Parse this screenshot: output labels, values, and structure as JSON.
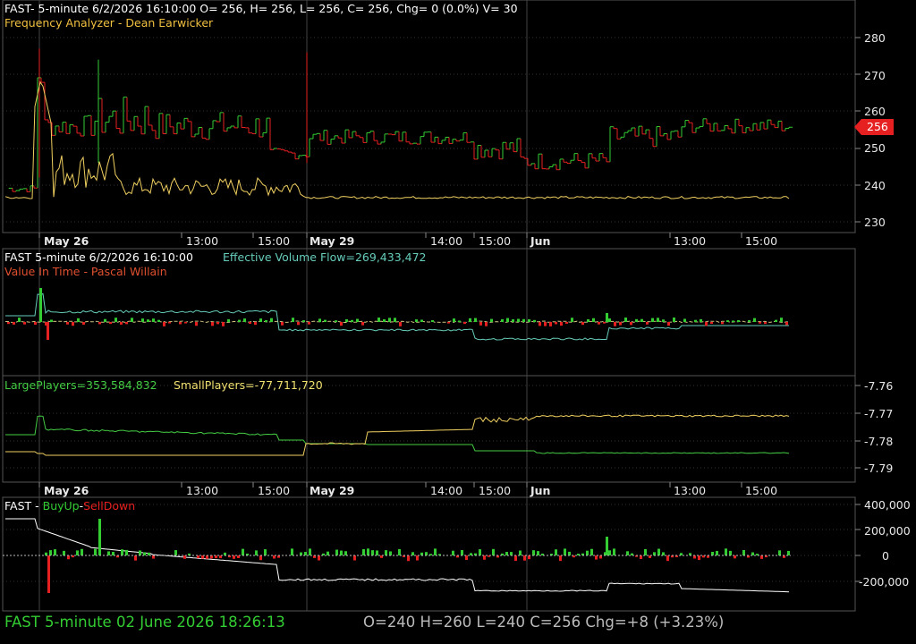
{
  "pane1": {
    "header": "FAST- 5-minute 6/2/2026 16:10:00 O= 256, H= 256, L= 256, C= 256, Chg= 0 (0.0%) V= 30",
    "study": "Frequency Analyzer - Dean Earwicker",
    "price_badge": "256",
    "axis_labels": [
      "280",
      "270",
      "260",
      "250",
      "240",
      "230"
    ]
  },
  "date_axis": [
    "May 26",
    "13:00",
    "15:00",
    "May 29",
    "14:00",
    "15:00",
    "Jun",
    "13:00",
    "15:00"
  ],
  "pane2": {
    "header_left": "FAST 5-minute  6/2/2026 16:10:00",
    "header_study": "Effective Volume Flow=269,433,472",
    "study2": "Value In Time - Pascal Willain"
  },
  "pane3": {
    "large_players": "LargePlayers=353,584,832",
    "small_players": "SmallPlayers=-77,711,720",
    "axis_labels": [
      "-7.76",
      "-7.77",
      "-7.78",
      "-7.79"
    ]
  },
  "pane4": {
    "prefix": "FAST - ",
    "buy": "BuyUp",
    "dash": "-",
    "sell": "SellDown",
    "axis_labels": [
      "400,000",
      "200,000",
      "0",
      "-200,000"
    ]
  },
  "footer": {
    "symbol": "FAST  5-minute   02 June 2026 18:26:13",
    "ohlc": "O=240  H=260  L=240  C=256  Chg=+8 (+3.23%)"
  },
  "colors": {
    "up": "#33cc33",
    "down": "#e62020",
    "yellow": "#f0d060",
    "cyan": "#66ccbb",
    "green_line": "#44cc44",
    "white": "#ffffff"
  }
}
